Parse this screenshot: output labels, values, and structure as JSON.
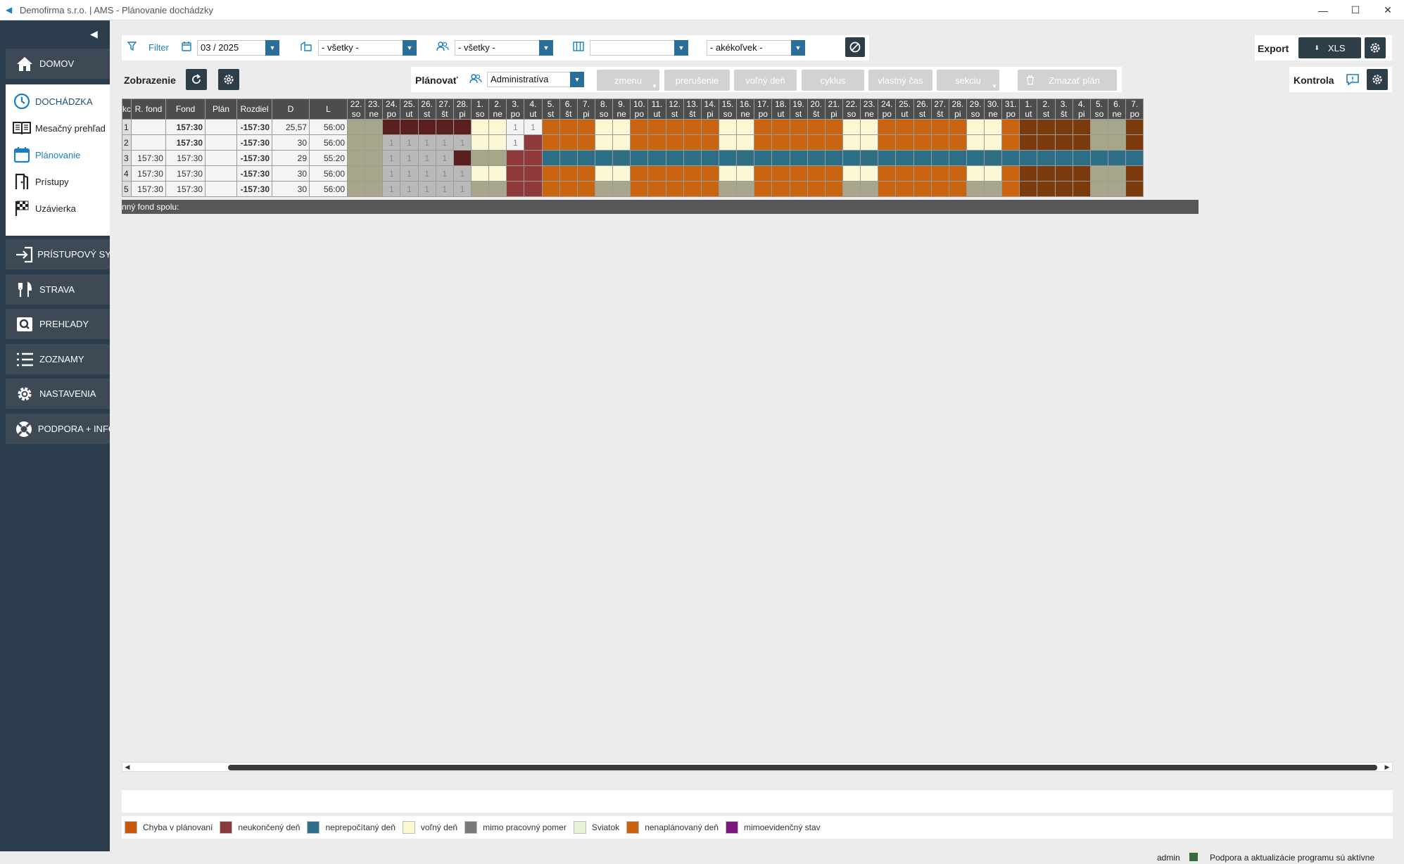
{
  "window": {
    "title": "Demofirma s.r.o. | AMS - Plánovanie dochádzky",
    "minimize": "—",
    "maximize": "☐",
    "close": "✕"
  },
  "sidebar": {
    "top_items": [
      {
        "label": "DOMOV",
        "icon": "home-icon"
      }
    ],
    "group": {
      "header": "DOCHÁDZKA",
      "items": [
        {
          "label": "Mesačný prehľad",
          "icon": "book-icon"
        },
        {
          "label": "Plánovanie",
          "icon": "calendar-icon",
          "active": true
        },
        {
          "label": "Prístupy",
          "icon": "door-icon"
        },
        {
          "label": "Uzávierka",
          "icon": "checkered-flag-icon"
        }
      ]
    },
    "bottom_items": [
      {
        "label": "PRÍSTUPOVÝ SYS",
        "icon": "login-icon"
      },
      {
        "label": "STRAVA",
        "icon": "cutlery-icon"
      },
      {
        "label": "PREHĽADY",
        "icon": "search-icon"
      },
      {
        "label": "ZOZNAMY",
        "icon": "list-icon"
      },
      {
        "label": "NASTAVENIA",
        "icon": "gear-icon"
      },
      {
        "label": "PODPORA + INFO",
        "icon": "lifebuoy-icon"
      }
    ]
  },
  "filter": {
    "label": "Filter",
    "period": "03 / 2025",
    "building": "- všetky -",
    "people": "- všetky -",
    "category": "",
    "any": "- akékoľvek -"
  },
  "export": {
    "label": "Export",
    "xls": "XLS"
  },
  "kontrola": {
    "label": "Kontrola"
  },
  "zobrazenie": {
    "label": "Zobrazenie"
  },
  "planovat": {
    "label": "Plánovať",
    "group": "Administratíva",
    "buttons": [
      "zmenu",
      "prerušenie",
      "voľný deň",
      "cyklus",
      "vlastný čas",
      "sekciu"
    ],
    "delete": "Zmazať plán"
  },
  "table": {
    "headers": [
      "kcie",
      "R. fond",
      "Fond",
      "Plán",
      "Rozdiel",
      "D",
      "L"
    ],
    "days": [
      {
        "d": "22.",
        "w": "so"
      },
      {
        "d": "23.",
        "w": "ne"
      },
      {
        "d": "24.",
        "w": "po"
      },
      {
        "d": "25.",
        "w": "ut"
      },
      {
        "d": "26.",
        "w": "st"
      },
      {
        "d": "27.",
        "w": "št"
      },
      {
        "d": "28.",
        "w": "pi"
      },
      {
        "d": "1.",
        "w": "so"
      },
      {
        "d": "2.",
        "w": "ne"
      },
      {
        "d": "3.",
        "w": "po"
      },
      {
        "d": "4.",
        "w": "ut"
      },
      {
        "d": "5.",
        "w": "st"
      },
      {
        "d": "6.",
        "w": "št"
      },
      {
        "d": "7.",
        "w": "pi"
      },
      {
        "d": "8.",
        "w": "so"
      },
      {
        "d": "9.",
        "w": "ne"
      },
      {
        "d": "10.",
        "w": "po"
      },
      {
        "d": "11.",
        "w": "ut"
      },
      {
        "d": "12.",
        "w": "st"
      },
      {
        "d": "13.",
        "w": "št"
      },
      {
        "d": "14.",
        "w": "pi"
      },
      {
        "d": "15.",
        "w": "so"
      },
      {
        "d": "16.",
        "w": "ne"
      },
      {
        "d": "17.",
        "w": "po"
      },
      {
        "d": "18.",
        "w": "ut"
      },
      {
        "d": "19.",
        "w": "st"
      },
      {
        "d": "20.",
        "w": "št"
      },
      {
        "d": "21.",
        "w": "pi"
      },
      {
        "d": "22.",
        "w": "so"
      },
      {
        "d": "23.",
        "w": "ne"
      },
      {
        "d": "24.",
        "w": "po"
      },
      {
        "d": "25.",
        "w": "ut"
      },
      {
        "d": "26.",
        "w": "st"
      },
      {
        "d": "27.",
        "w": "št"
      },
      {
        "d": "28.",
        "w": "pi"
      },
      {
        "d": "29.",
        "w": "so"
      },
      {
        "d": "30.",
        "w": "ne"
      },
      {
        "d": "31.",
        "w": "po"
      },
      {
        "d": "1.",
        "w": "ut"
      },
      {
        "d": "2.",
        "w": "st"
      },
      {
        "d": "3.",
        "w": "št"
      },
      {
        "d": "4.",
        "w": "pi"
      },
      {
        "d": "5.",
        "w": "so"
      },
      {
        "d": "6.",
        "w": "ne"
      },
      {
        "d": "7.",
        "w": "po"
      }
    ],
    "rows": [
      {
        "no": "1",
        "rfond": "",
        "fond": "157:30",
        "plan": "",
        "rozdiel": "-157:30",
        "d": "25,57",
        "l": "56:00",
        "cells": "gg DDDDD yy w1w1 OOO yy OOOOO yy OOOOO yy OOOOO yy O BBBB gg B"
      },
      {
        "no": "2",
        "rfond": "",
        "fond": "157:30",
        "plan": "",
        "rozdiel": "-157:30",
        "d": "30",
        "l": "56:00",
        "cells": "gg s1s1s1s1s1 yy w1R OOO yy OOOOO yy OOOOO yy OOOOO yy O BBBB gg B"
      },
      {
        "no": "3",
        "rfond": "157:30",
        "fond": "157:30",
        "plan": "",
        "rozdiel": "-157:30",
        "d": "29",
        "l": "55:20",
        "cells": "gg s1s1s1s1D gg RR TTT TT TTTTT TT TTTTT TT TTTTT TT T TTTT TT T"
      },
      {
        "no": "4",
        "rfond": "157:30",
        "fond": "157:30",
        "plan": "",
        "rozdiel": "-157:30",
        "d": "30",
        "l": "56:00",
        "cells": "gg s1s1s1s1s1 yy RR OOO yy OOOOO yy OOOOO yy OOOOO yy O BBBB gg B"
      },
      {
        "no": "5",
        "rfond": "157:30",
        "fond": "157:30",
        "plan": "",
        "rozdiel": "-157:30",
        "d": "30",
        "l": "56:00",
        "cells": "gg s1s1s1s1s1 gg RR OOO gg OOOOO gg OOOOO gg OOOOO gg O BBBB gg B"
      }
    ],
    "summary_label": "nný fond spolu:"
  },
  "legend": [
    {
      "label": "Chyba v plánovaní",
      "color": "#c8580e"
    },
    {
      "label": "neukončený deň",
      "color": "#8b3a3a"
    },
    {
      "label": "neprepočítaný deň",
      "color": "#2d6f88"
    },
    {
      "label": "voľný deň",
      "color": "#fbf7d2"
    },
    {
      "label": "mimo pracovný pomer",
      "color": "#7a7a7a"
    },
    {
      "label": "Sviatok",
      "color": "#e6f3d6"
    },
    {
      "label": "nenaplánovaný deň",
      "color": "#c8620e"
    },
    {
      "label": "mimoevidenčný stav",
      "color": "#7b1a7b"
    }
  ],
  "status": {
    "user": "admin",
    "message": "Podpora a aktualizácie programu sú aktívne"
  }
}
